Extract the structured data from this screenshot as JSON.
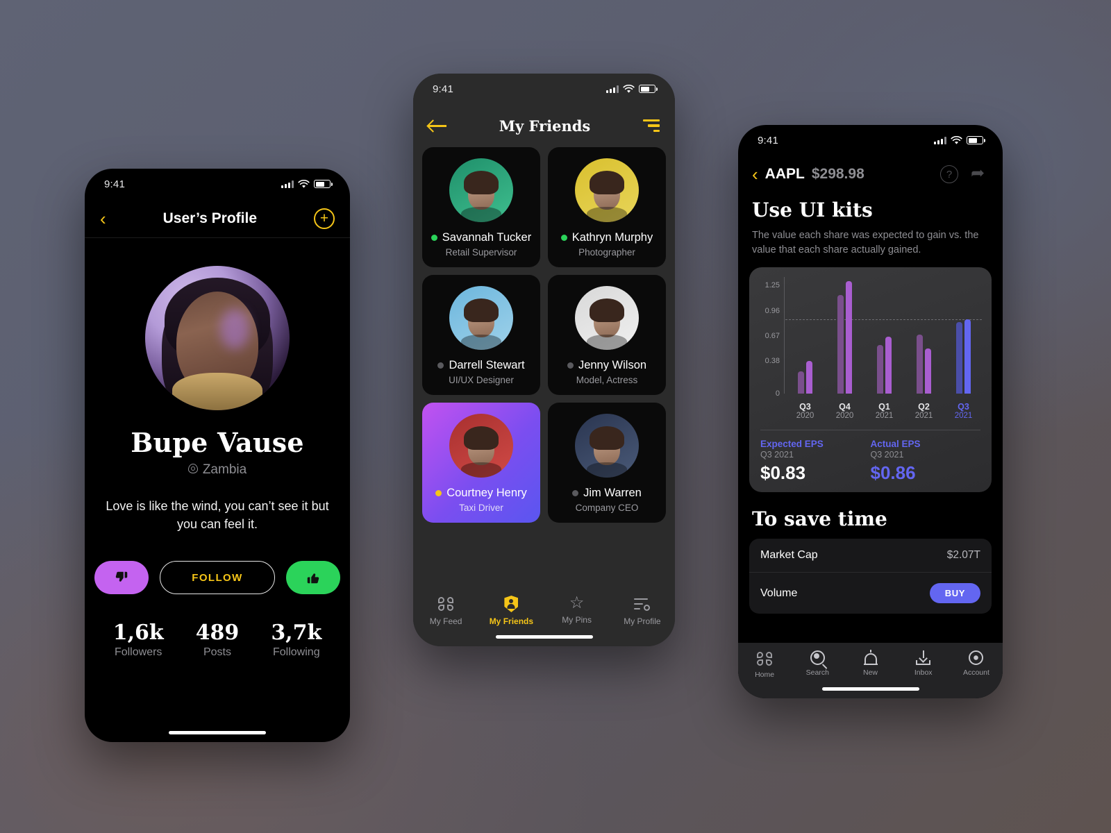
{
  "colors": {
    "accent_yellow": "#f5c518",
    "accent_purple": "#c463f0",
    "accent_green": "#2bd35a",
    "accent_indigo": "#6366f1"
  },
  "profile_screen": {
    "status": {
      "time": "9:41"
    },
    "nav": {
      "back": "‹",
      "title": "User’s Profile",
      "add": "+"
    },
    "name": "Bupe Vause",
    "location": "Zambia",
    "bio": "Love is like the wind, you can’t see it but you can feel it.",
    "actions": {
      "dislike": "👎",
      "follow": "FOLLOW",
      "like": "👍"
    },
    "stats": [
      {
        "num": "1,6k",
        "label": "Followers"
      },
      {
        "num": "489",
        "label": "Posts"
      },
      {
        "num": "3,7k",
        "label": "Following"
      }
    ]
  },
  "friends_screen": {
    "status": {
      "time": "9:41"
    },
    "nav": {
      "title": "My Friends"
    },
    "friends": [
      {
        "name": "Savannah Tucker",
        "role": "Retail Supervisor",
        "status": "online",
        "active": false,
        "av1": "#1f8f6a",
        "av2": "#3fbf8f"
      },
      {
        "name": "Kathryn Murphy",
        "role": "Photographer",
        "status": "online",
        "active": false,
        "av1": "#d9c02e",
        "av2": "#e8d55a"
      },
      {
        "name": "Darrell Stewart",
        "role": "UI/UX Designer",
        "status": "offline",
        "active": false,
        "av1": "#6cb6dd",
        "av2": "#9fd2ea"
      },
      {
        "name": "Jenny Wilson",
        "role": "Model, Actress",
        "status": "offline",
        "active": false,
        "av1": "#d8d8d8",
        "av2": "#f0f0f0"
      },
      {
        "name": "Courtney Henry",
        "role": "Taxi Driver",
        "status": "away",
        "active": true,
        "av1": "#a8302f",
        "av2": "#d04a46"
      },
      {
        "name": "Jim Warren",
        "role": "Company CEO",
        "status": "offline",
        "active": false,
        "av1": "#2a3550",
        "av2": "#4a5a78"
      }
    ],
    "tabs": [
      {
        "label": "My Feed",
        "icon": "grid-icon",
        "active": false
      },
      {
        "label": "My Friends",
        "icon": "shield-icon",
        "active": true
      },
      {
        "label": "My Pins",
        "icon": "star-icon",
        "active": false
      },
      {
        "label": "My Profile",
        "icon": "profile-icon",
        "active": false
      }
    ]
  },
  "stock_screen": {
    "status": {
      "time": "9:41"
    },
    "nav": {
      "ticker": "AAPL",
      "price": "$298.98"
    },
    "heading": "Use UI kits",
    "subtitle": "The value each share was expected to gain vs. the value that each share actually gained.",
    "eps": {
      "expected": {
        "title": "Expected EPS",
        "period": "Q3 2021",
        "value": "$0.83"
      },
      "actual": {
        "title": "Actual EPS",
        "period": "Q3 2021",
        "value": "$0.86"
      }
    },
    "section2_title": "To save time",
    "rows": [
      {
        "label": "Market Cap",
        "value": "$2.07T",
        "button": null
      },
      {
        "label": "Volume",
        "value": null,
        "button": "BUY"
      }
    ],
    "tabs": [
      {
        "label": "Home",
        "icon": "grid-icon"
      },
      {
        "label": "Search",
        "icon": "search-icon"
      },
      {
        "label": "New",
        "icon": "bell-icon"
      },
      {
        "label": "Inbox",
        "icon": "download-inbox-icon"
      },
      {
        "label": "Account",
        "icon": "gear-icon"
      }
    ]
  },
  "chart_data": {
    "type": "bar",
    "title": "Expected vs Actual EPS",
    "xlabel": "",
    "ylabel": "",
    "categories": [
      "Q3 2020",
      "Q4 2020",
      "Q1 2021",
      "Q2 2021",
      "Q3 2021"
    ],
    "quarters": [
      "Q3",
      "Q4",
      "Q1",
      "Q2",
      "Q3"
    ],
    "years": [
      "2020",
      "2020",
      "2021",
      "2021",
      "2021"
    ],
    "yticks": [
      "0",
      "0.38",
      "0.67",
      "0.96",
      "1.25"
    ],
    "ylim": [
      0,
      1.35
    ],
    "grid": false,
    "reference_line": 0.86,
    "highlight_index": 4,
    "legend": [
      "Expected EPS",
      "Actual EPS"
    ],
    "series": [
      {
        "name": "Expected EPS",
        "values": [
          0.26,
          1.14,
          0.56,
          0.68,
          0.83
        ],
        "color": "#7a4f8c"
      },
      {
        "name": "Actual EPS",
        "values": [
          0.38,
          1.3,
          0.66,
          0.52,
          0.86
        ],
        "color": "#a95ed0"
      }
    ],
    "highlight_colors": {
      "expected": "#4a4ea8",
      "actual": "#6366f1"
    }
  }
}
